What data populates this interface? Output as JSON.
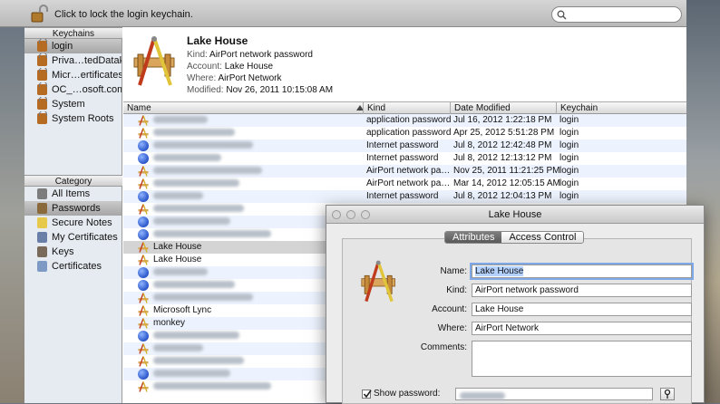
{
  "toolbar": {
    "lock_label": "Click to lock the login keychain."
  },
  "sidebar": {
    "keychains_header": "Keychains",
    "keychains": [
      {
        "label": "login",
        "selected": true
      },
      {
        "label": "Priva…tedDatak"
      },
      {
        "label": "Micr…ertificates"
      },
      {
        "label": "OC_…osoft.com"
      },
      {
        "label": "System"
      },
      {
        "label": "System Roots"
      }
    ],
    "category_header": "Category",
    "categories": [
      {
        "label": "All Items",
        "icon": "all-items-icon"
      },
      {
        "label": "Passwords",
        "icon": "key-icon",
        "selected": true
      },
      {
        "label": "Secure Notes",
        "icon": "note-icon"
      },
      {
        "label": "My Certificates",
        "icon": "certificate-icon"
      },
      {
        "label": "Keys",
        "icon": "key-icon"
      },
      {
        "label": "Certificates",
        "icon": "certificate-icon"
      }
    ]
  },
  "info": {
    "title": "Lake House",
    "kind_key": "Kind:",
    "kind": "AirPort network password",
    "account_key": "Account:",
    "account": "Lake House",
    "where_key": "Where:",
    "where": "AirPort Network",
    "modified_key": "Modified:",
    "modified": "Nov 26, 2011 10:15:08 AM"
  },
  "columns": {
    "name": "Name",
    "kind": "Kind",
    "date": "Date Modified",
    "keychain": "Keychain"
  },
  "rows": [
    {
      "icon": "app",
      "name": "",
      "kind": "application password",
      "date": "Jul 16, 2012 1:22:18 PM",
      "keychain": "login"
    },
    {
      "icon": "app",
      "name": "",
      "kind": "application password",
      "date": "Apr 25, 2012 5:51:28 PM",
      "keychain": "login"
    },
    {
      "icon": "globe",
      "name": "",
      "kind": "Internet password",
      "date": "Jul 8, 2012 12:42:48 PM",
      "keychain": "login"
    },
    {
      "icon": "globe",
      "name": "",
      "kind": "Internet password",
      "date": "Jul 8, 2012 12:13:12 PM",
      "keychain": "login"
    },
    {
      "icon": "app",
      "name": "",
      "kind": "AirPort network pa…",
      "date": "Nov 25, 2011 11:21:25 PM",
      "keychain": "login"
    },
    {
      "icon": "app",
      "name": "",
      "kind": "AirPort network pa…",
      "date": "Mar 14, 2012 12:05:15 AM",
      "keychain": "login"
    },
    {
      "icon": "globe",
      "name": "",
      "kind": "Internet password",
      "date": "Jul 8, 2012 12:04:13 PM",
      "keychain": "login"
    },
    {
      "icon": "app",
      "name": "",
      "kind": "",
      "date": "",
      "keychain": ""
    },
    {
      "icon": "globe",
      "name": "",
      "kind": "",
      "date": "",
      "keychain": ""
    },
    {
      "icon": "globe",
      "name": "",
      "kind": "",
      "date": "",
      "keychain": ""
    },
    {
      "icon": "app",
      "name": "Lake House",
      "kind": "",
      "date": "",
      "keychain": "",
      "selected": true
    },
    {
      "icon": "app",
      "name": "Lake House",
      "kind": "",
      "date": "",
      "keychain": ""
    },
    {
      "icon": "globe",
      "name": "",
      "kind": "",
      "date": "",
      "keychain": ""
    },
    {
      "icon": "globe",
      "name": "",
      "kind": "",
      "date": "",
      "keychain": ""
    },
    {
      "icon": "app",
      "name": "",
      "kind": "",
      "date": "",
      "keychain": ""
    },
    {
      "icon": "app",
      "name": "Microsoft Lync",
      "kind": "",
      "date": "",
      "keychain": ""
    },
    {
      "icon": "app",
      "name": "monkey",
      "kind": "",
      "date": "",
      "keychain": ""
    },
    {
      "icon": "globe",
      "name": "",
      "kind": "",
      "date": "",
      "keychain": ""
    },
    {
      "icon": "app",
      "name": "",
      "kind": "",
      "date": "",
      "keychain": ""
    },
    {
      "icon": "app",
      "name": "",
      "kind": "",
      "date": "",
      "keychain": ""
    },
    {
      "icon": "globe",
      "name": "",
      "kind": "",
      "date": "",
      "keychain": ""
    },
    {
      "icon": "app",
      "name": "",
      "kind": "",
      "date": "",
      "keychain": ""
    }
  ],
  "dialog": {
    "title": "Lake House",
    "tab_attributes": "Attributes",
    "tab_access": "Access Control",
    "name_label": "Name:",
    "name_value": "Lake House",
    "kind_label": "Kind:",
    "kind_value": "AirPort network password",
    "account_label": "Account:",
    "account_value": "Lake House",
    "where_label": "Where:",
    "where_value": "AirPort Network",
    "comments_label": "Comments:",
    "show_password_label": "Show password:",
    "show_password_checked": true
  }
}
